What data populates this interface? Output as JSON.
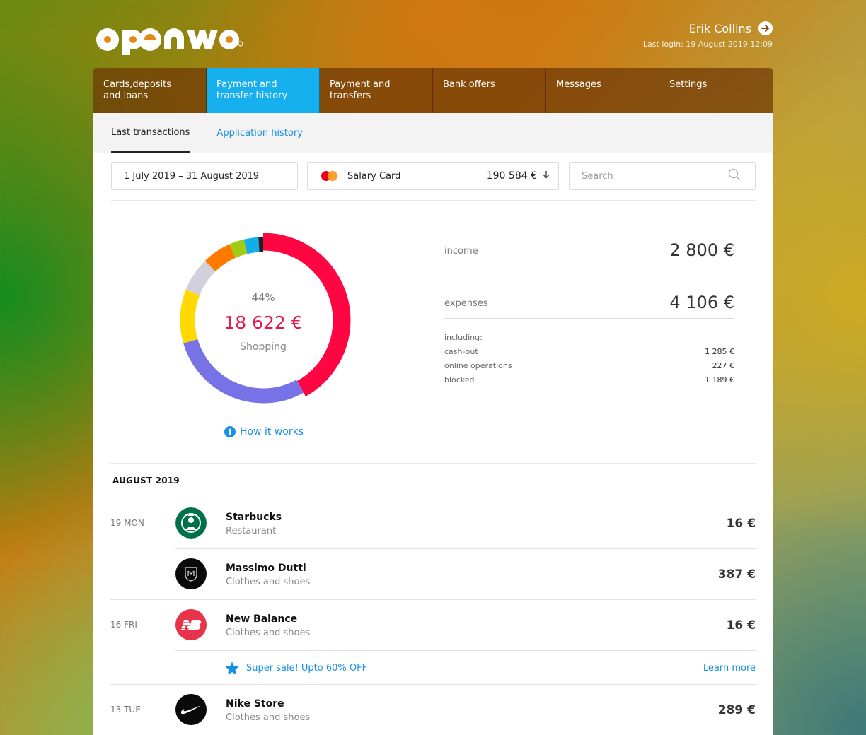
{
  "header": {
    "logo_text": "openway",
    "user_name": "Erik Collins",
    "last_login": "Last login: 19 August 2019 12:09"
  },
  "nav": [
    {
      "line1": "Cards,deposits",
      "line2": "and loans"
    },
    {
      "line1": "Payment and",
      "line2": "transfer history"
    },
    {
      "line1": "Payment and",
      "line2": "transfers"
    },
    {
      "line1": "Bank offers",
      "line2": ""
    },
    {
      "line1": "Messages",
      "line2": ""
    },
    {
      "line1": "Settings",
      "line2": ""
    }
  ],
  "subtabs": {
    "last_transactions": "Last transactions",
    "application_history": "Application history"
  },
  "filters": {
    "date_range": "1 July 2019  –  31 August 2019",
    "card_name": "Salary Card",
    "card_balance": "190 584 €",
    "search_placeholder": "Search"
  },
  "donut": {
    "percent": "44%",
    "amount": "18 622 €",
    "label": "Shopping",
    "how_it_works": "How it works",
    "segments_pct": [
      44,
      30,
      11,
      7,
      6,
      3,
      3,
      1
    ],
    "segment_colors": [
      "#ff0542",
      "#7773e6",
      "#ffd900",
      "#d3d0dd",
      "#ff7b00",
      "#a0cc15",
      "#11aee8",
      "#222222"
    ]
  },
  "summary": {
    "income_label": "income",
    "income_value": "2 800 €",
    "expenses_label": "expenses",
    "expenses_value": "4 106 €",
    "including": "including:",
    "cashout_label": "cash-out",
    "cashout_value": "1 285 €",
    "online_label": "online operations",
    "online_value": "227 €",
    "blocked_label": "blocked",
    "blocked_value": "1 189 €"
  },
  "transactions": {
    "month": "AUGUST 2019",
    "days": [
      "19 MON",
      "16 FRI",
      "13 TUE"
    ],
    "items": [
      {
        "merchant": "Starbucks",
        "category": "Restaurant",
        "amount": "16 €"
      },
      {
        "merchant": "Massimo Dutti",
        "category": "Clothes and shoes",
        "amount": "387 €"
      },
      {
        "merchant": "New Balance",
        "category": "Clothes and shoes",
        "amount": "16 €"
      },
      {
        "merchant": "Nike Store",
        "category": "Clothes and shoes",
        "amount": "289 €"
      }
    ],
    "promo_text": "Super sale! Upto 60% OFF",
    "promo_link": "Learn more"
  },
  "colors": {
    "accent_blue": "#17b0ef",
    "link_blue": "#1890e0",
    "amount_red": "#ea1548"
  }
}
